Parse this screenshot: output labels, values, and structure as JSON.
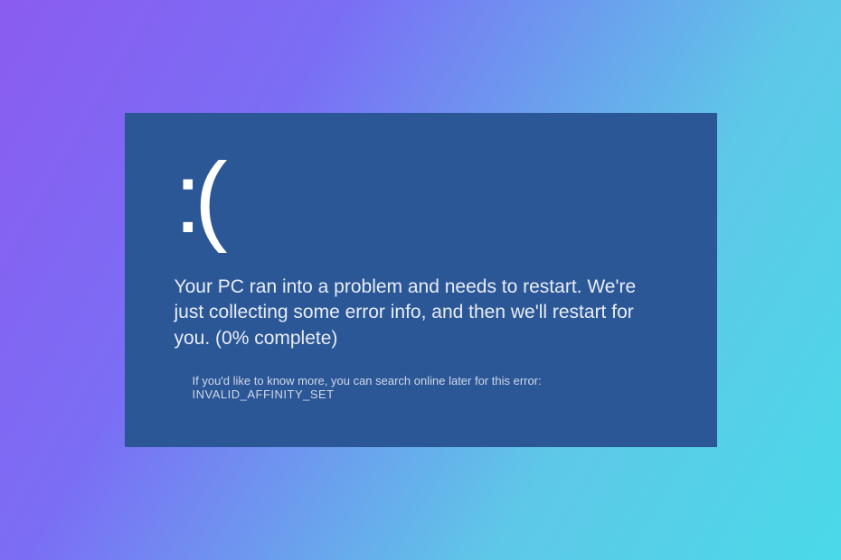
{
  "bsod": {
    "emoticon": ":(",
    "message": "Your PC ran into a problem and needs to restart. We're just collecting some error info, and then we'll restart for you. (0% complete)",
    "hint_prefix": "If you'd like to know more, you can search online later for this error: ",
    "error_code": "INVALID_AFFINITY_SET",
    "colors": {
      "panel_bg": "#2b5797",
      "text": "#ffffff"
    }
  }
}
